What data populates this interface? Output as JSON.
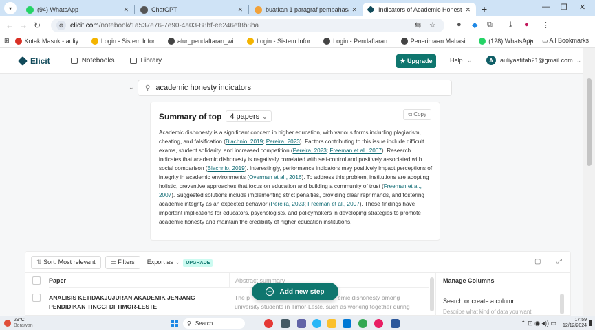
{
  "browser": {
    "tabs": [
      {
        "label": "(94) WhatsApp",
        "color": "#25d366",
        "active": false
      },
      {
        "label": "ChatGPT",
        "color": "#555555",
        "active": false
      },
      {
        "label": "buatkan 1 paragraf pembahasa",
        "color": "#f2a23a",
        "active": false
      },
      {
        "label": "Indicators of Academic Honest",
        "color": "#114a5a",
        "active": true
      }
    ],
    "url_domain": "elicit.com",
    "url_path": "/notebook/1a537e76-7e90-4a03-88bf-ee246ef8b8ba",
    "bookmarks": [
      {
        "label": "Kotak Masuk - auliy...",
        "color": "#d93025"
      },
      {
        "label": "Login - Sistem Infor...",
        "color": "#f4b400"
      },
      {
        "label": "alur_pendaftaran_wi...",
        "color": "#444444"
      },
      {
        "label": "Login - Sistem Infor...",
        "color": "#f4b400"
      },
      {
        "label": "Login - Pendaftaran...",
        "color": "#444444"
      },
      {
        "label": "Penerimaan Mahasi...",
        "color": "#444444"
      },
      {
        "label": "(128) WhatsApp",
        "color": "#25d366"
      }
    ],
    "all_bookmarks": "All Bookmarks",
    "overflow": "»"
  },
  "header": {
    "logo": "Elicit",
    "nav": [
      "Notebooks",
      "Library"
    ],
    "upgrade": "★ Upgrade",
    "help": "Help",
    "user_initial": "A",
    "user_email": "auliyaafifah21@gmail.com"
  },
  "search": {
    "query": "academic honesty indicators"
  },
  "summary": {
    "title": "Summary of top",
    "papers": "4 papers",
    "copy": "Copy",
    "segments": [
      {
        "t": "Academic dishonesty is a significant concern in higher education, with various forms including plagiarism, cheating, and falsification ("
      },
      {
        "t": "Blachnio, 2019",
        "c": true
      },
      {
        "t": "; "
      },
      {
        "t": "Pereira, 2023",
        "c": true
      },
      {
        "t": "). Factors contributing to this issue include difficult exams, student solidarity, and increased competition ("
      },
      {
        "t": "Pereira, 2023",
        "c": true
      },
      {
        "t": "; "
      },
      {
        "t": "Freeman et al., 2007",
        "c": true
      },
      {
        "t": "). Research indicates that academic dishonesty is negatively correlated with self-control and positively associated with social comparison ("
      },
      {
        "t": "Blachnio, 2019",
        "c": true
      },
      {
        "t": "). Interestingly, performance indicators may positively impact perceptions of integrity in academic environments ("
      },
      {
        "t": "Overman et al., 2016",
        "c": true
      },
      {
        "t": "). To address this problem, institutions are adopting holistic, preventive approaches that focus on education and building a community of trust ("
      },
      {
        "t": "Freeman et al., 2007",
        "c": true
      },
      {
        "t": "). Suggested solutions include implementing strict penalties, providing clear reprimands, and fostering academic integrity as an expected behavior ("
      },
      {
        "t": "Pereira, 2023",
        "c": true
      },
      {
        "t": "; "
      },
      {
        "t": "Freeman et al., 2007",
        "c": true
      },
      {
        "t": "). These findings have important implications for educators, psychologists, and policymakers in developing strategies to promote academic honesty and maintain the credibility of higher education institutions."
      }
    ]
  },
  "toolbar": {
    "sort": "Sort: Most relevant",
    "filters": "Filters",
    "export": "Export as",
    "upgrade_badge": "UPGRADE"
  },
  "table": {
    "col_paper": "Paper",
    "col_abstract": "Abstract summary",
    "row1_title_line1": "ANALISIS KETIDAKJUJURAN AKADEMIK JENJANG",
    "row1_title_line2": "PENDIDIKAN TINGGI DI TIMOR-LESTE",
    "row1_abstract_line1": "The p",
    "row1_abstract_line1b": "emic dishonesty among",
    "row1_abstract_line2": "university students in Timor-Leste, such as working together during"
  },
  "manage_columns": {
    "title": "Manage Columns",
    "search": "Search or create a column",
    "desc": "Describe what kind of data you want"
  },
  "add_step": "Add new step",
  "taskbar": {
    "temp": "29°C",
    "weather": "Berawan",
    "search": "Search",
    "time": "17:59",
    "date": "12/12/2024"
  }
}
